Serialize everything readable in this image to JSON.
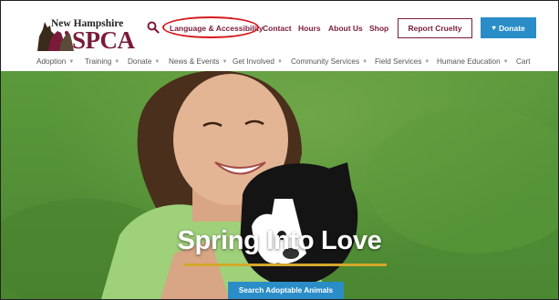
{
  "logo": {
    "line1": "New Hampshire",
    "line2": "SPCA"
  },
  "header": {
    "search_icon": "search-icon",
    "links": [
      {
        "label": "Language & Accessibility"
      },
      {
        "label": "Contact"
      },
      {
        "label": "Hours"
      },
      {
        "label": "About Us"
      },
      {
        "label": "Shop"
      }
    ],
    "report_label": "Report Cruelty",
    "donate_label": "Donate",
    "donate_icon": "heart-icon"
  },
  "nav": {
    "items": [
      {
        "label": "Adoption",
        "caret": "▼"
      },
      {
        "label": "Training",
        "caret": "▼"
      },
      {
        "label": "Donate",
        "caret": "▼"
      },
      {
        "label": "News & Events",
        "caret": "▼"
      },
      {
        "label": "Get Involved",
        "caret": "▼"
      },
      {
        "label": "Community Services",
        "caret": "▼"
      },
      {
        "label": "Field Services",
        "caret": "▼"
      },
      {
        "label": "Humane Education",
        "caret": "▼"
      },
      {
        "label": "Cart",
        "caret": ""
      }
    ]
  },
  "hero": {
    "title": "Spring Into Love",
    "cta_label": "Search Adoptable Animals"
  },
  "colors": {
    "brand": "#7a1b3a",
    "accent": "#2a8dc7",
    "highlight_ring": "#d6191e",
    "rule": "#d4a82a"
  }
}
